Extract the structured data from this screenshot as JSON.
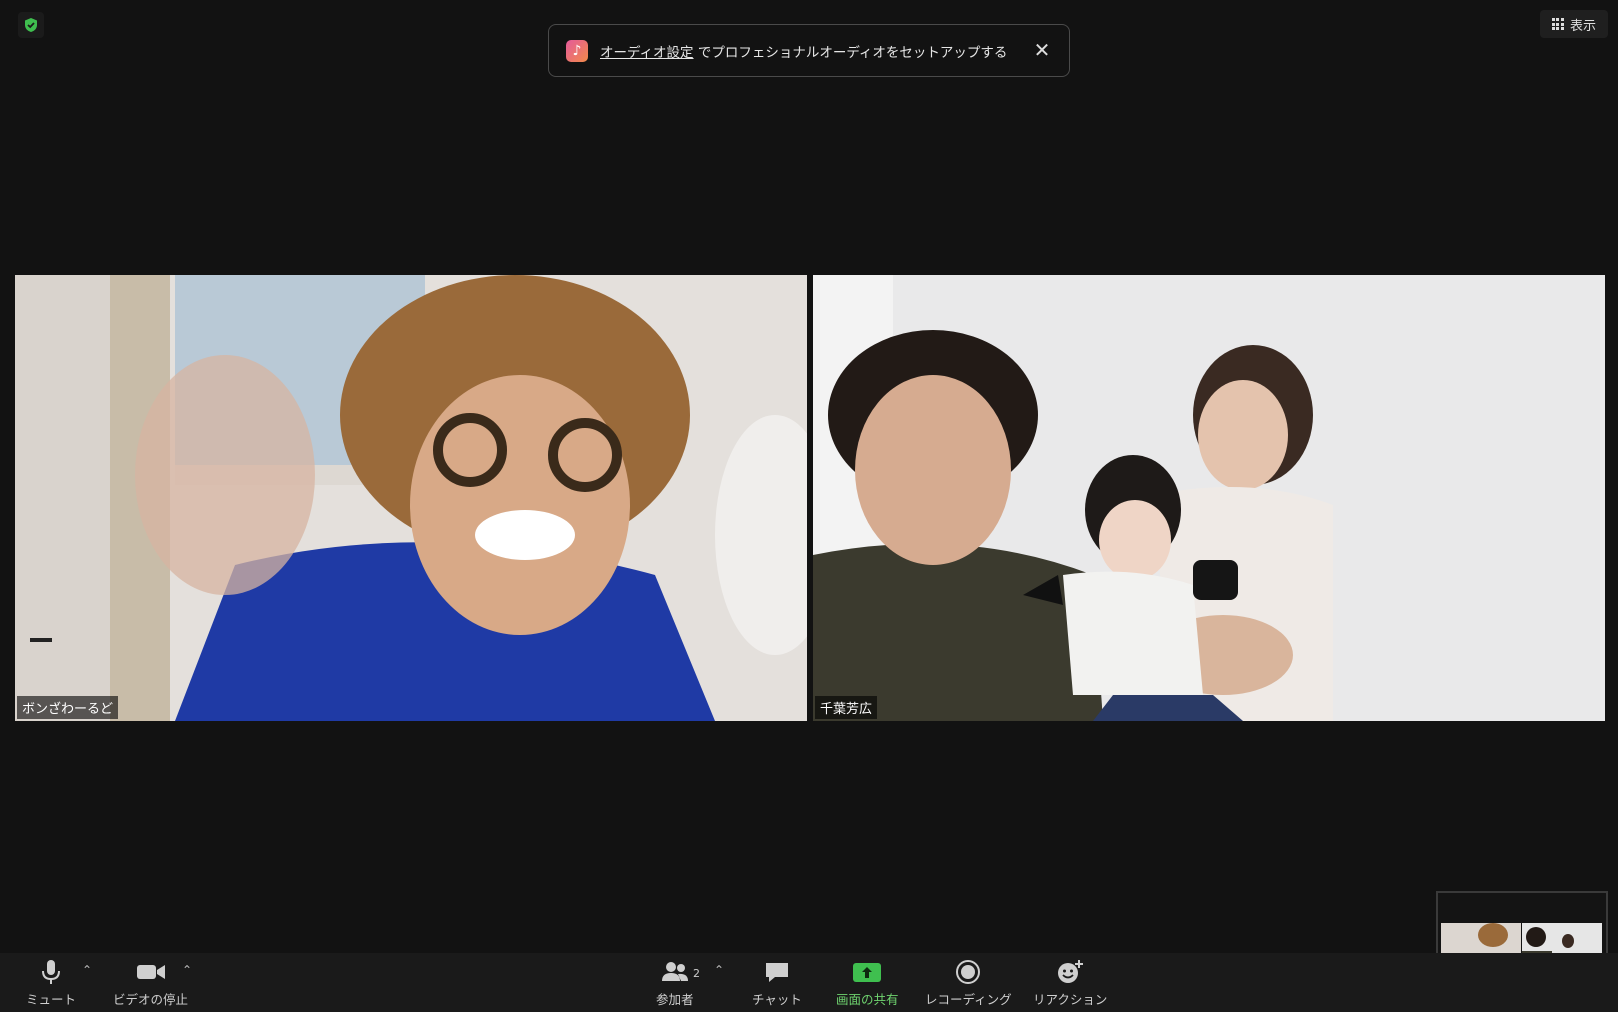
{
  "top_bar": {
    "view_label": "表示"
  },
  "banner": {
    "link_text": "オーディオ設定",
    "message": " でプロフェショナルオーディオをセットアップする"
  },
  "participants": [
    {
      "name": "ボンざわーるど"
    },
    {
      "name": "千葉芳広"
    }
  ],
  "toolbar": {
    "mute_label": "ミュート",
    "video_label": "ビデオの停止",
    "participants_label": "参加者",
    "participants_count": "2",
    "chat_label": "チャット",
    "share_label": "画面の共有",
    "record_label": "レコーディング",
    "reaction_label": "リアクション"
  },
  "colors": {
    "background": "#121212",
    "share_green": "#3fbf4f",
    "security_green": "#3fbf4f"
  }
}
